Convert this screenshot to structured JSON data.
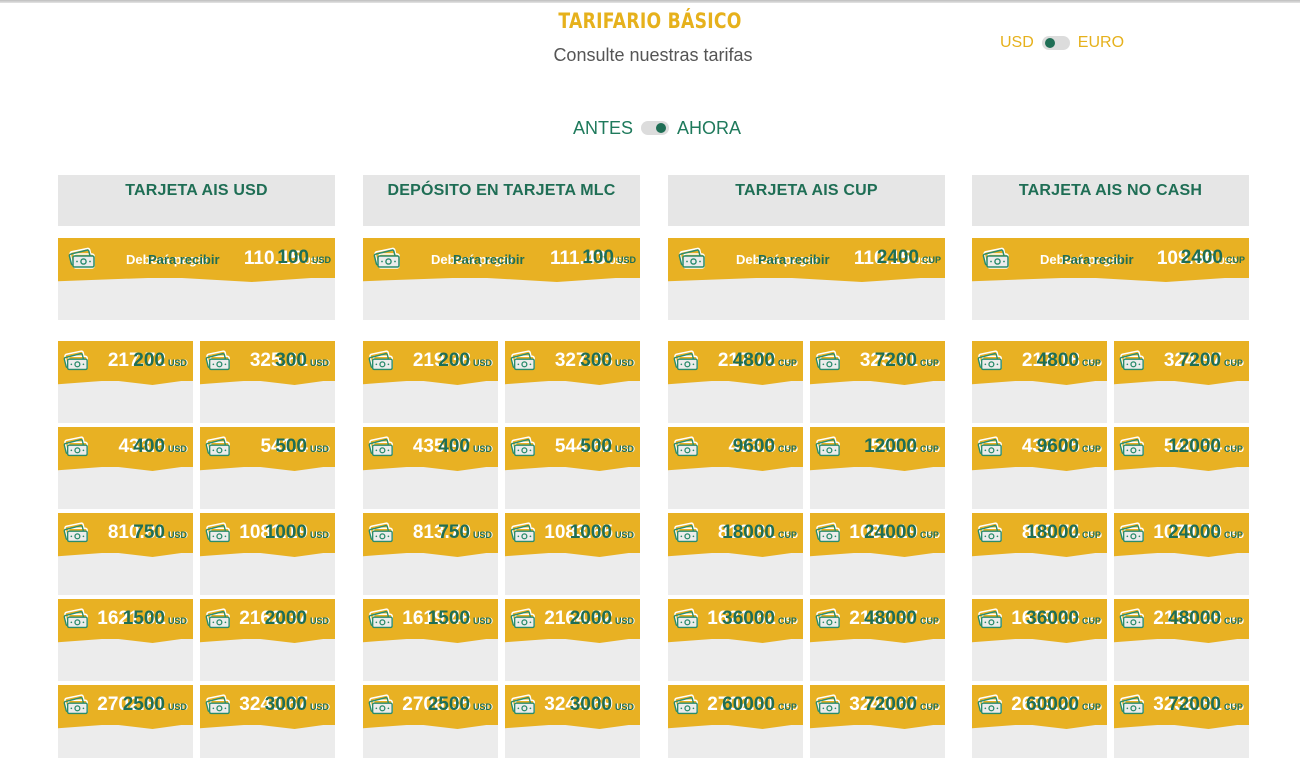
{
  "header": {
    "title": "TARIFARIO BÁSICO",
    "subtitle": "Consulte nuestras tarifas"
  },
  "currency_toggle": {
    "left": "USD",
    "right": "EURO",
    "selected": "USD"
  },
  "period_toggle": {
    "left": "ANTES",
    "right": "AHORA",
    "selected": "AHORA"
  },
  "labels": {
    "pay": "Deberá pagar",
    "receive": "Para recibir"
  },
  "colors": {
    "accent_yellow": "#e8b123",
    "green": "#1f6e55",
    "gray": "#ececec"
  },
  "columns": [
    {
      "title": "TARJETA AIS USD",
      "unit": "USD",
      "main": {
        "pay": "110.15",
        "pay_unit": "USD",
        "receive": "100",
        "receive_unit": "USD"
      },
      "cells": [
        {
          "pay": "217.72",
          "receive": "200"
        },
        {
          "pay": "325.61",
          "receive": "300"
        },
        {
          "pay": "433.5",
          "receive": "400"
        },
        {
          "pay": "541.4",
          "receive": "500"
        },
        {
          "pay": "810.81",
          "receive": "750"
        },
        {
          "pay": "1081.19",
          "receive": "1000"
        },
        {
          "pay": "1621.62",
          "receive": "1500"
        },
        {
          "pay": "2162.37",
          "receive": "2000"
        },
        {
          "pay": "2702.81",
          "receive": "2500"
        },
        {
          "pay": "3240.67",
          "receive": "3000"
        }
      ]
    },
    {
      "title": "DEPÓSITO EN TARJETA MLC",
      "unit": "USD",
      "main": {
        "pay": "111.43",
        "pay_unit": "USD",
        "receive": "100",
        "receive_unit": "USD"
      },
      "cells": [
        {
          "pay": "219.38",
          "receive": "200"
        },
        {
          "pay": "327.33",
          "receive": "300"
        },
        {
          "pay": "435.97",
          "receive": "400"
        },
        {
          "pay": "544.62",
          "receive": "500"
        },
        {
          "pay": "813.79",
          "receive": "750"
        },
        {
          "pay": "1083.65",
          "receive": "1000"
        },
        {
          "pay": "1619.48",
          "receive": "1500"
        },
        {
          "pay": "2164.52",
          "receive": "2000"
        },
        {
          "pay": "2706.35",
          "receive": "2500"
        },
        {
          "pay": "3244.69",
          "receive": "3000"
        }
      ]
    },
    {
      "title": "TARJETA AIS CUP",
      "unit": "CUP",
      "main": {
        "pay": "110.15",
        "pay_unit": "USD",
        "receive": "2400",
        "receive_unit": "CUP"
      },
      "cells": [
        {
          "pay": "217.72",
          "receive": "4800"
        },
        {
          "pay": "325.61",
          "receive": "7200"
        },
        {
          "pay": "433.5",
          "receive": "9600"
        },
        {
          "pay": "541.4",
          "receive": "12000"
        },
        {
          "pay": "810.81",
          "receive": "18000"
        },
        {
          "pay": "1081.19",
          "receive": "24000"
        },
        {
          "pay": "1621.62",
          "receive": "36000"
        },
        {
          "pay": "2162.37",
          "receive": "48000"
        },
        {
          "pay": "2702.81",
          "receive": "60000"
        },
        {
          "pay": "3240.67",
          "receive": "72000"
        }
      ]
    },
    {
      "title": "TARJETA AIS NO CASH",
      "unit": "CUP",
      "main": {
        "pay": "109.66",
        "pay_unit": "USD",
        "receive": "2400",
        "receive_unit": "CUP"
      },
      "cells": [
        {
          "pay": "217.18",
          "receive": "4800"
        },
        {
          "pay": "324.97",
          "receive": "7200"
        },
        {
          "pay": "432.75",
          "receive": "9600"
        },
        {
          "pay": "540.54",
          "receive": "12000"
        },
        {
          "pay": "809.74",
          "receive": "18000"
        },
        {
          "pay": "1079.79",
          "receive": "24000"
        },
        {
          "pay": "1619.48",
          "receive": "36000"
        },
        {
          "pay": "2159.48",
          "receive": "48000"
        },
        {
          "pay": "2699.27",
          "receive": "60000"
        },
        {
          "pay": "3236.81",
          "receive": "72000"
        }
      ]
    }
  ]
}
